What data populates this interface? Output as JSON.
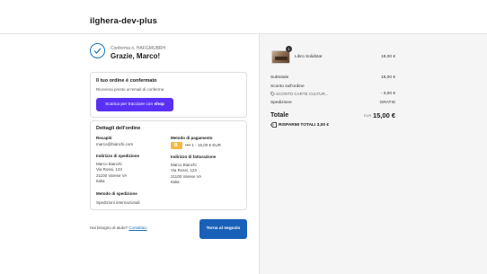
{
  "header": {
    "store_name": "ilghera-dev-plus"
  },
  "confirmation": {
    "code": "Conferma n. HAFGMUBRH",
    "thanks": "Grazie, Marco!"
  },
  "order_confirmed": {
    "title": "Il tuo ordine è confermato",
    "description": "Riceverai presto un'email di conferma",
    "shop_button_prefix": "Scarica per tracciare con",
    "shop_button_brand": "shop"
  },
  "order_details": {
    "title": "Dettagli dell'ordine",
    "contacts_label": "Recapiti",
    "contacts_value": "marco@bianchi.com",
    "shipping_address_label": "Indirizzo di spedizione",
    "shipping_address": [
      "Marco Bianchi",
      "Via Rossi, 123",
      "21100 Varese VA",
      "Italia"
    ],
    "shipping_method_label": "Metodo di spedizione",
    "shipping_method_value": "Spedizioni internazionali",
    "payment_method_label": "Metodo di pagamento",
    "payment_badge": "B",
    "payment_value": "•••• 1 - 15,00 € EUR",
    "billing_address_label": "Indirizzo di fatturazione",
    "billing_address": [
      "Marco Bianchi",
      "Via Rossi, 123",
      "21100 Varese VA",
      "Italia"
    ]
  },
  "footer": {
    "help_text": "Hai bisogno di aiuto?",
    "help_link": "Contattaci",
    "return_button": "Torna al negozio"
  },
  "summary": {
    "product": {
      "name": "Libro Solidstat",
      "price": "18,00 €",
      "quantity": "1"
    },
    "subtotal_label": "Subtotale",
    "subtotal_value": "18,00 €",
    "order_discount_label": "Sconto sull'ordine",
    "discount_code": "SCONTO CARTE CULTUR...",
    "discount_value": "- 3,00 €",
    "shipping_label": "Spedizione",
    "shipping_value": "GRATIS",
    "total_label": "Totale",
    "currency": "EUR",
    "total_value": "15,00 €",
    "savings_label": "RISPARMI TOTALI",
    "savings_value": "3,00 €"
  },
  "colors": {
    "accent": "#1961b8",
    "shop_purple": "#5a31f4",
    "badge": "#f5b840"
  }
}
